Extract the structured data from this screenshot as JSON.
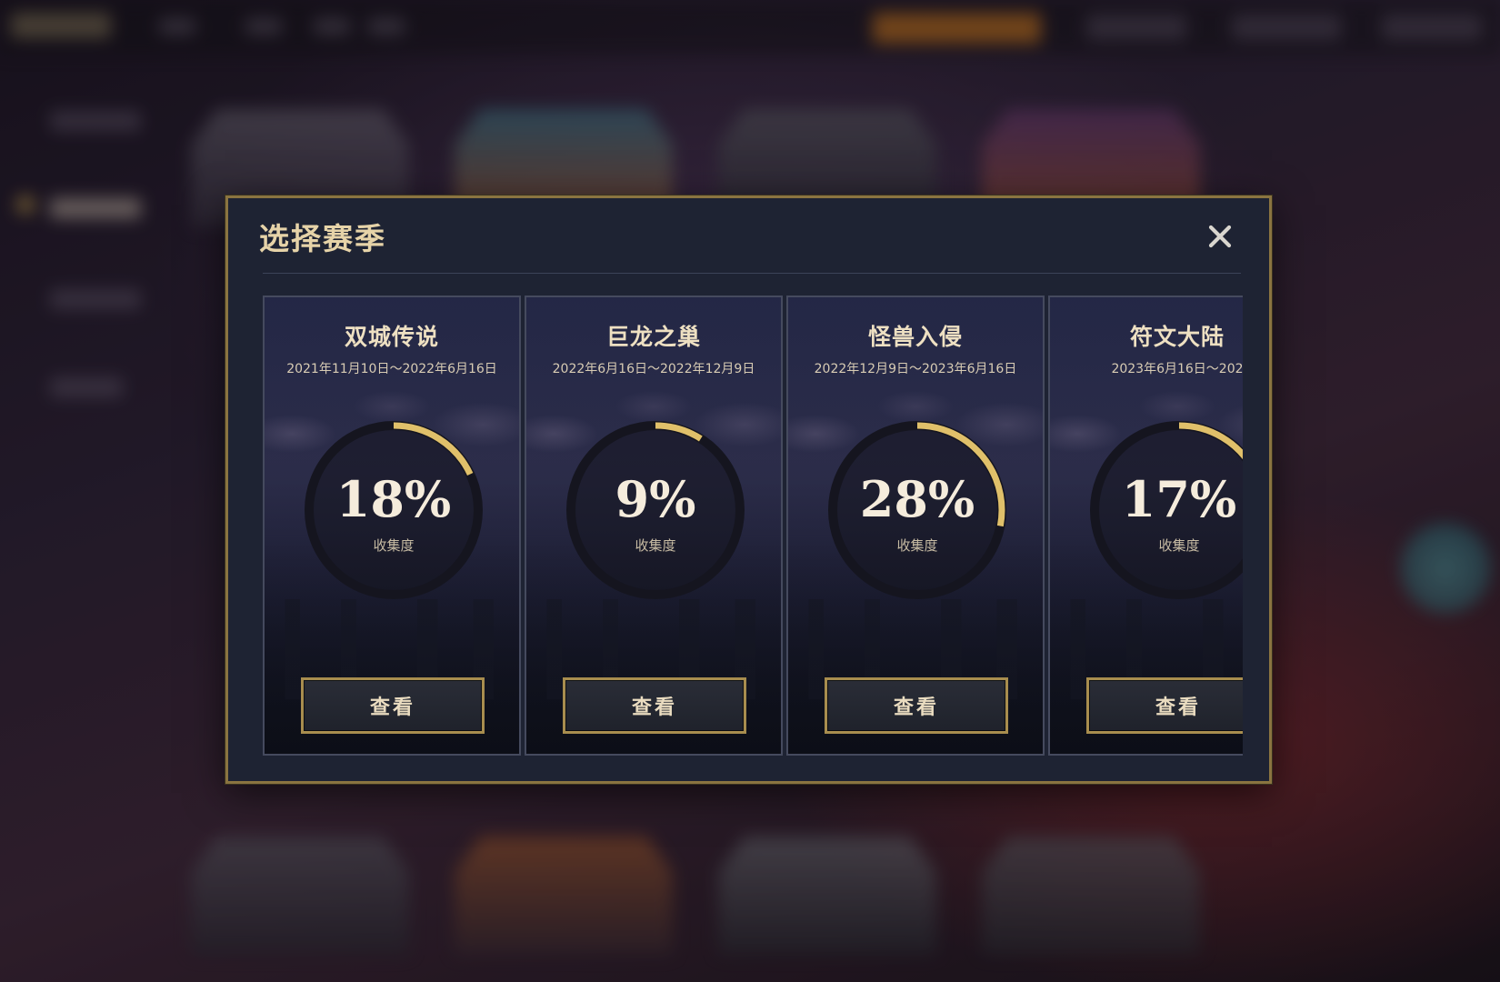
{
  "modal": {
    "title": "选择赛季",
    "close_icon": "close-icon"
  },
  "seasons": [
    {
      "name": "双城传说",
      "dates": "2021年11月10日～2022年6月16日",
      "progress": 18,
      "progress_text": "18%",
      "progress_label": "收集度",
      "button_label": "查看"
    },
    {
      "name": "巨龙之巢",
      "dates": "2022年6月16日～2022年12月9日",
      "progress": 9,
      "progress_text": "9%",
      "progress_label": "收集度",
      "button_label": "查看"
    },
    {
      "name": "怪兽入侵",
      "dates": "2022年12月9日～2023年6月16日",
      "progress": 28,
      "progress_text": "28%",
      "progress_label": "收集度",
      "button_label": "查看"
    },
    {
      "name": "符文大陆",
      "dates": "2023年6月16日～202",
      "progress": 17,
      "progress_text": "17%",
      "progress_label": "收集度",
      "button_label": "查看"
    }
  ],
  "colors": {
    "accent_gold": "#e0c06a",
    "ring_track": "#15151f",
    "modal_border": "#8a7440",
    "modal_bg": "#1e2333"
  }
}
